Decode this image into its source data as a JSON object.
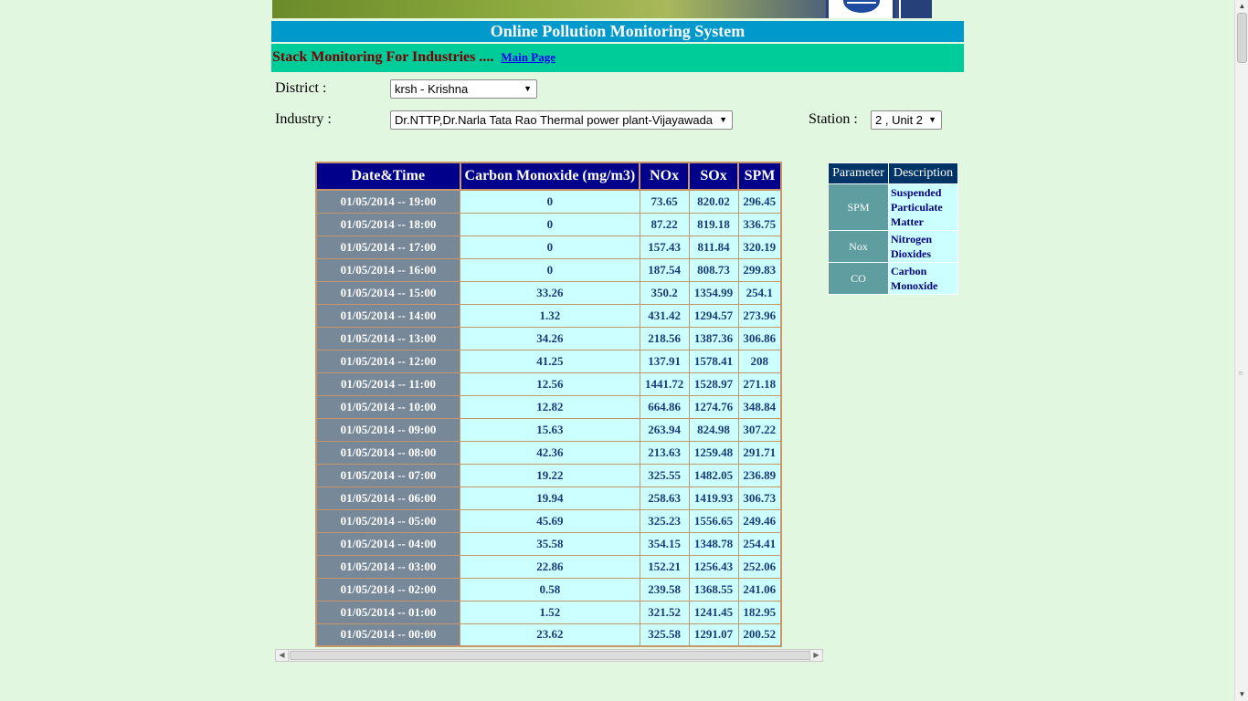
{
  "header": {
    "title": "Online Pollution Monitoring System",
    "subtitle": "Stack Monitoring For Industries ....",
    "main_page_link": "Main Page"
  },
  "filters": {
    "district_label": "District :",
    "district_value": "krsh - Krishna",
    "industry_label": "Industry :",
    "industry_value": "Dr.NTTP,Dr.Narla Tata Rao Thermal power plant-Vijayawada",
    "station_label": "Station :",
    "station_value": "2 , Unit 2"
  },
  "data_table": {
    "columns": [
      "Date&Time",
      "Carbon Monoxide (mg/m3)",
      "NOx",
      "SOx",
      "SPM"
    ],
    "rows": [
      [
        "01/05/2014 -- 19:00",
        "0",
        "73.65",
        "820.02",
        "296.45"
      ],
      [
        "01/05/2014 -- 18:00",
        "0",
        "87.22",
        "819.18",
        "336.75"
      ],
      [
        "01/05/2014 -- 17:00",
        "0",
        "157.43",
        "811.84",
        "320.19"
      ],
      [
        "01/05/2014 -- 16:00",
        "0",
        "187.54",
        "808.73",
        "299.83"
      ],
      [
        "01/05/2014 -- 15:00",
        "33.26",
        "350.2",
        "1354.99",
        "254.1"
      ],
      [
        "01/05/2014 -- 14:00",
        "1.32",
        "431.42",
        "1294.57",
        "273.96"
      ],
      [
        "01/05/2014 -- 13:00",
        "34.26",
        "218.56",
        "1387.36",
        "306.86"
      ],
      [
        "01/05/2014 -- 12:00",
        "41.25",
        "137.91",
        "1578.41",
        "208"
      ],
      [
        "01/05/2014 -- 11:00",
        "12.56",
        "1441.72",
        "1528.97",
        "271.18"
      ],
      [
        "01/05/2014 -- 10:00",
        "12.82",
        "664.86",
        "1274.76",
        "348.84"
      ],
      [
        "01/05/2014 -- 09:00",
        "15.63",
        "263.94",
        "824.98",
        "307.22"
      ],
      [
        "01/05/2014 -- 08:00",
        "42.36",
        "213.63",
        "1259.48",
        "291.71"
      ],
      [
        "01/05/2014 -- 07:00",
        "19.22",
        "325.55",
        "1482.05",
        "236.89"
      ],
      [
        "01/05/2014 -- 06:00",
        "19.94",
        "258.63",
        "1419.93",
        "306.73"
      ],
      [
        "01/05/2014 -- 05:00",
        "45.69",
        "325.23",
        "1556.65",
        "249.46"
      ],
      [
        "01/05/2014 -- 04:00",
        "35.58",
        "354.15",
        "1348.78",
        "254.41"
      ],
      [
        "01/05/2014 -- 03:00",
        "22.86",
        "152.21",
        "1256.43",
        "252.06"
      ],
      [
        "01/05/2014 -- 02:00",
        "0.58",
        "239.58",
        "1368.55",
        "241.06"
      ],
      [
        "01/05/2014 -- 01:00",
        "1.52",
        "321.52",
        "1241.45",
        "182.95"
      ],
      [
        "01/05/2014 -- 00:00",
        "23.62",
        "325.58",
        "1291.07",
        "200.52"
      ]
    ]
  },
  "legend_table": {
    "columns": [
      "Parameter",
      "Description"
    ],
    "rows": [
      [
        "SPM",
        "Suspended Particulate Matter"
      ],
      [
        "Nox",
        "Nitrogen Dioxides"
      ],
      [
        "CO",
        "Carbon Monoxide"
      ]
    ]
  },
  "colors": {
    "page_bg": "#e2f7e0",
    "title_bar": "#0099cc",
    "sub_bar": "#00cc99",
    "table_header": "#00008b",
    "datetime_cell": "#778899",
    "value_cell": "#ccffff"
  }
}
